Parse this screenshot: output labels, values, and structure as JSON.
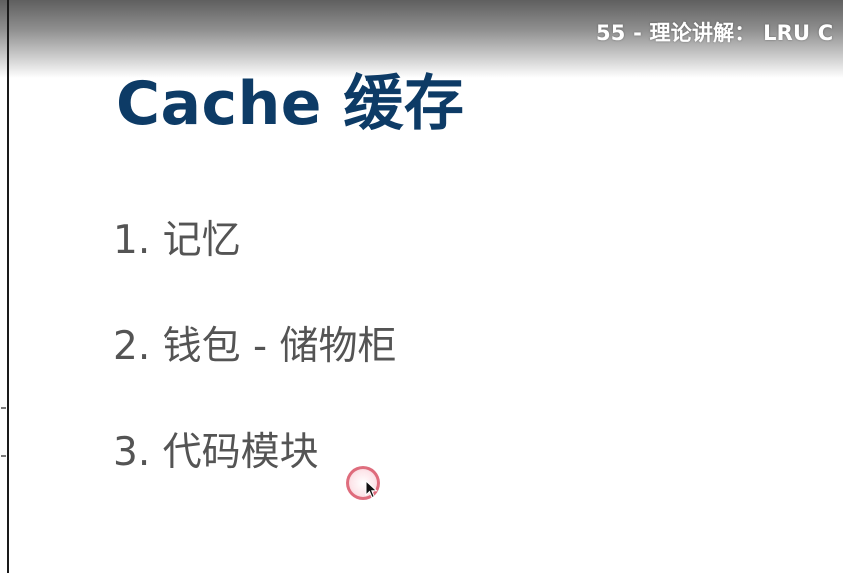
{
  "video": {
    "title": "55 - 理论讲解： LRU C"
  },
  "slide": {
    "title": "Cache 缓存",
    "items": [
      "1. 记忆",
      "2. 钱包 - 储物柜",
      "3. 代码模块"
    ]
  },
  "colors": {
    "title": "#0d3b66",
    "body_text": "#545454",
    "cursor_ring": "#d6485c"
  }
}
